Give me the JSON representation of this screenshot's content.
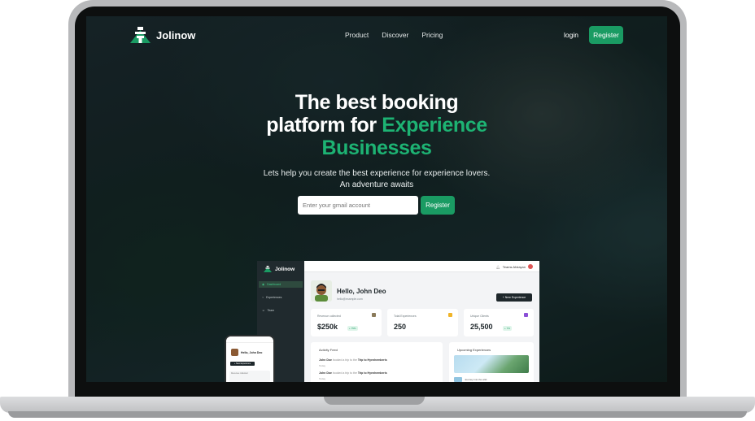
{
  "brand": {
    "name": "Jolinow",
    "accent": "#1a9b63",
    "accent_text": "#1db373"
  },
  "nav": {
    "links": [
      "Product",
      "Discover",
      "Pricing"
    ],
    "login": "login",
    "register": "Register"
  },
  "hero": {
    "title_line1": "The best booking",
    "title_line2_plain": "platform for ",
    "title_line2_accent": "Experience",
    "title_line3_accent": "Businesses",
    "subtitle_line1": "Lets help you create the best experience for experience lovers.",
    "subtitle_line2": "An adventure awaits",
    "email_placeholder": "Enter your gmail account",
    "register": "Register"
  },
  "dashboard": {
    "logo": "Jolinow",
    "sidebar": [
      "Dashboard",
      "Experiences",
      "Team"
    ],
    "user_name": "Teams Afolayan",
    "greeting": "Hello, John Deo",
    "email": "hello@example.com",
    "new_button": "+ New Experience",
    "cards": [
      {
        "label": "Revenue collected",
        "value": "$250k",
        "badge": "+ 75%",
        "icon": "money-icon"
      },
      {
        "label": "Total Experiences",
        "value": "250",
        "badge": "",
        "icon": "trophy-icon"
      },
      {
        "label": "Unique Clients",
        "value": "25,500",
        "badge": "+ 7%",
        "icon": "clients-icon"
      }
    ],
    "activity": {
      "title": "Activity Feed",
      "rows": [
        {
          "name": "John Doe",
          "action": "booked a trip to the",
          "place": "Trip to Hyenhemberis",
          "time": "Today"
        },
        {
          "name": "John Doe",
          "action": "booked a trip to the",
          "place": "Trip to Hyenhemberis",
          "time": "Today"
        }
      ]
    },
    "upcoming": {
      "title": "Upcoming Experiences",
      "item": "Journey into the wild"
    }
  },
  "phone": {
    "greeting": "Hello, John Deo",
    "button": "+ New Experience",
    "card": "Revenue collected"
  }
}
